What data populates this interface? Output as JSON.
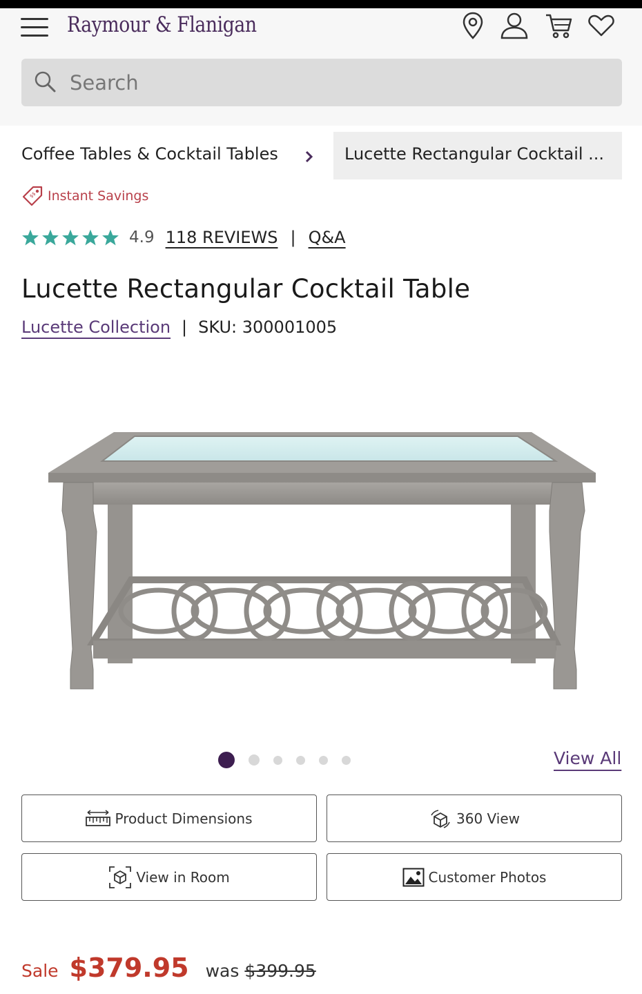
{
  "header": {
    "logo": "Raymour & Flanigan",
    "search_placeholder": "Search"
  },
  "breadcrumb": {
    "parent": "Coffee Tables & Cocktail Tables",
    "current": "Lucette Rectangular Cocktail ..."
  },
  "promo": {
    "label": "Instant Savings"
  },
  "rating": {
    "stars": 5,
    "score": "4.9",
    "reviews_label": "118 REVIEWS",
    "qa_label": "Q&A"
  },
  "product": {
    "title": "Lucette Rectangular Cocktail Table",
    "collection": "Lucette Collection",
    "sku": "SKU: 300001005"
  },
  "gallery": {
    "image_count": 6,
    "active_index": 0,
    "view_all_label": "View All"
  },
  "actions": {
    "dimensions": "Product Dimensions",
    "view_360": "360 View",
    "view_room": "View in Room",
    "customer_photos": "Customer Photos"
  },
  "pricing": {
    "sale_label": "Sale",
    "sale_price": "$379.95",
    "was_label": "was",
    "was_price": "$399.95"
  },
  "colors": {
    "brand": "#4a2c5c",
    "star": "#3aa89b",
    "sale": "#c0392b"
  }
}
